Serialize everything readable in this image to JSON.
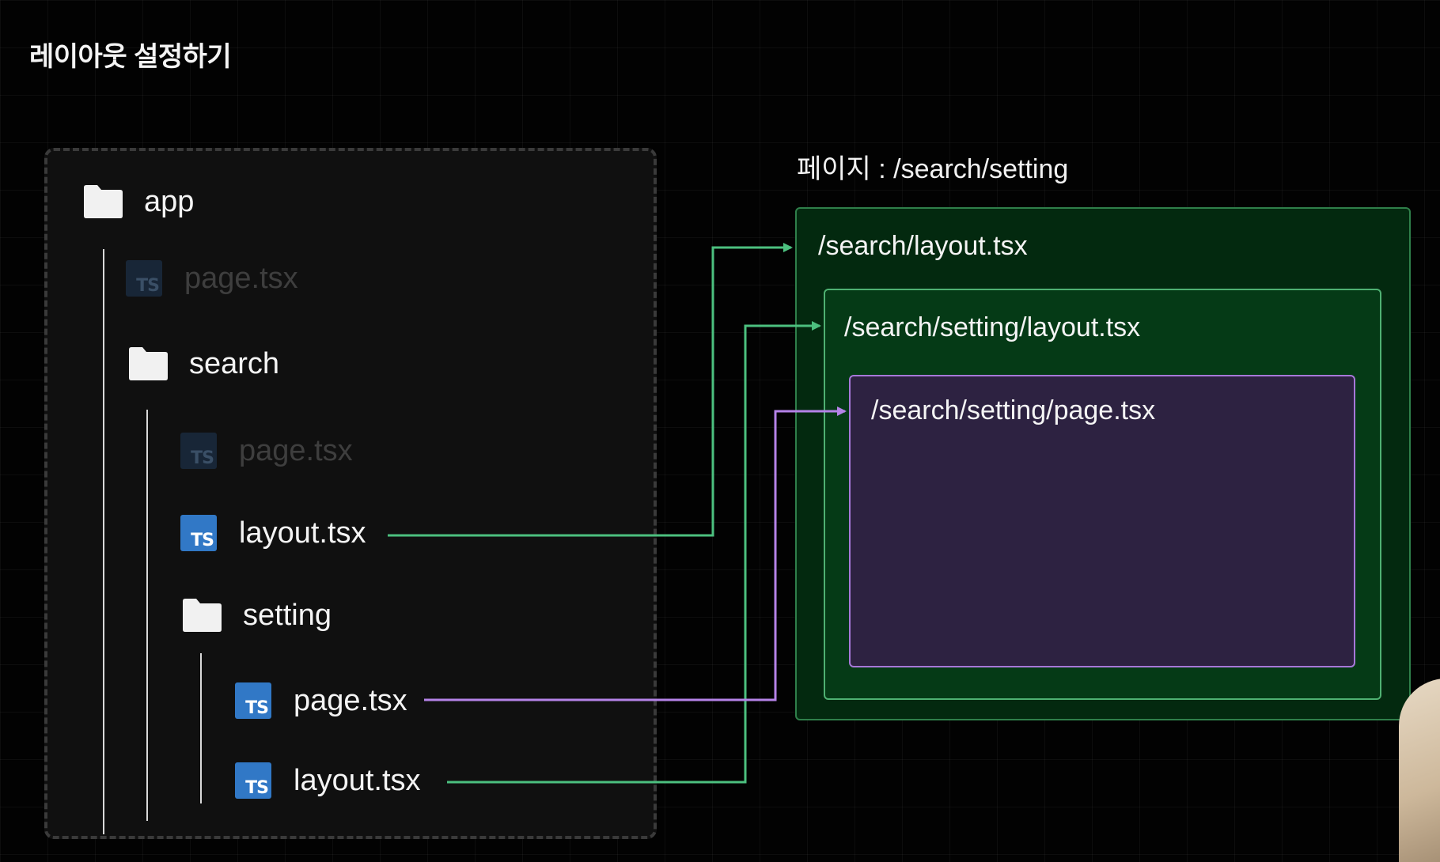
{
  "title": "레이아웃 설정하기",
  "tree": {
    "items": [
      {
        "id": "app",
        "type": "folder",
        "label": "app"
      },
      {
        "id": "app-page",
        "type": "ts",
        "label": "page.tsx",
        "dimmed": true
      },
      {
        "id": "search",
        "type": "folder",
        "label": "search"
      },
      {
        "id": "search-page",
        "type": "ts",
        "label": "page.tsx",
        "dimmed": true
      },
      {
        "id": "search-layout",
        "type": "ts",
        "label": "layout.tsx"
      },
      {
        "id": "setting",
        "type": "folder",
        "label": "setting"
      },
      {
        "id": "setting-page",
        "type": "ts",
        "label": "page.tsx"
      },
      {
        "id": "setting-layout",
        "type": "ts",
        "label": "layout.tsx"
      }
    ],
    "ts_badge": "TS"
  },
  "page_caption": "페이지 : /search/setting",
  "boxes": {
    "outer": "/search/layout.tsx",
    "middle": "/search/setting/layout.tsx",
    "inner": "/search/setting/page.tsx"
  },
  "colors": {
    "layout_arrow": "#4cc07f",
    "page_arrow": "#b583e8",
    "ts_icon": "#3178c6"
  }
}
